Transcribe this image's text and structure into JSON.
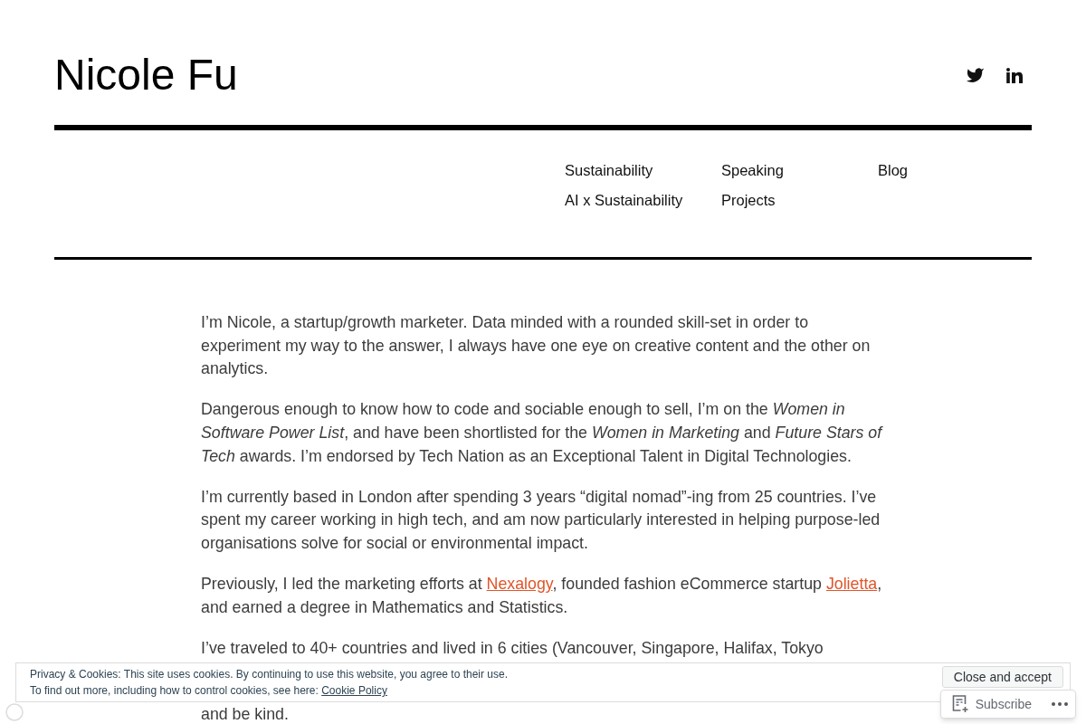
{
  "site_title": "Nicole Fu",
  "nav": [
    {
      "label": "Sustainability"
    },
    {
      "label": "Speaking"
    },
    {
      "label": "Blog"
    },
    {
      "label": "AI x Sustainability"
    },
    {
      "label": "Projects"
    }
  ],
  "paragraphs": [
    {
      "kind": "text",
      "text": "I’m Nicole, a startup/growth marketer. Data minded with a rounded skill-set in order to experiment my way to the answer, I always have one eye on creative content and the other on analytics."
    },
    {
      "kind": "text",
      "text": "Dangerous enough to know how to code and sociable enough to sell, I’m on the *Women in Software Power List*, and have been shortlisted for the *Women in Marketing* and *Future Stars of Tech* awards. I’m endorsed by Tech Nation as an Exceptional Talent in Digital Technologies."
    },
    {
      "kind": "text",
      "text": "I’m currently based in London after spending 3 years “digital nomad”-ing from 25 countries. I’ve spent my career working in high tech, and am now particularly interested in helping purpose-led organisations solve for social or environmental impact."
    },
    {
      "kind": "mixed",
      "segments": [
        {
          "kind": "text",
          "text": "Previously, I led the marketing efforts at "
        },
        {
          "kind": "link",
          "text": "Nexalogy"
        },
        {
          "kind": "text",
          "text": ", founded fashion eCommerce startup "
        },
        {
          "kind": "link",
          "text": "Jolietta"
        },
        {
          "kind": "text",
          "text": ", and earned a degree in Mathematics and Statistics."
        }
      ]
    },
    {
      "kind": "cut",
      "lines": [
        "I’ve traveled to 40+ countries and lived in 6 cities (Vancouver, Singapore, Halifax, Tokyo",
        "and be kind."
      ]
    }
  ],
  "cookie_banner": {
    "lines": [
      "Privacy & Cookies: This site uses cookies. By continuing to use this website, you agree to their use.",
      "To find out more, including how to control cookies, see here: "
    ],
    "link": "Cookie Policy",
    "button": "Close and accept"
  },
  "subscribe_bar": {
    "label": "Subscribe"
  }
}
